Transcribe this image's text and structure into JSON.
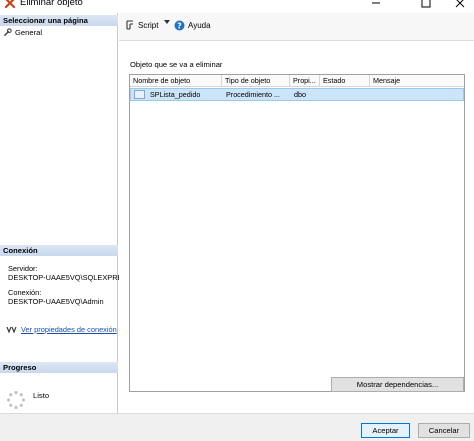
{
  "window": {
    "title": "Eliminar objeto",
    "minimize_glyph": "—",
    "maximize_glyph": "☐",
    "close_glyph": "✕"
  },
  "left_panel": {
    "select_page_title": "Seleccionar una página",
    "pages": [
      {
        "label": "General",
        "icon": "wrench-icon"
      }
    ],
    "connection_title": "Conexión",
    "server_label": "Servidor:",
    "server_value": "DESKTOP-UAAE5VQ\\SQLEXPRE",
    "connection_label": "Conexión:",
    "connection_value": "DESKTOP-UAAE5VQ\\Admin",
    "connection_link": "Ver propiedades de conexión",
    "progress_title": "Progreso",
    "progress_status": "Listo"
  },
  "toolbar": {
    "script_label": "Script",
    "help_label": "Ayuda"
  },
  "main": {
    "objects_label": "Objeto que se va a eliminar",
    "columns": [
      "Nombre de objeto",
      "Tipo de objeto",
      "Propi...",
      "Estado",
      "Mensaje"
    ],
    "rows": [
      {
        "name": "SPLista_pedido",
        "type": "Procedimiento ...",
        "owner": "dbo",
        "status": "",
        "message": ""
      }
    ],
    "show_dependencies_button": "Mostrar dependencias..."
  },
  "footer": {
    "accept_button": "Aceptar",
    "cancel_button": "Cancelar"
  },
  "colors": {
    "section_header": "#d3dff0",
    "selected_row": "#cce4f7",
    "link": "#1a4ea8",
    "accent": "#0078d7"
  }
}
